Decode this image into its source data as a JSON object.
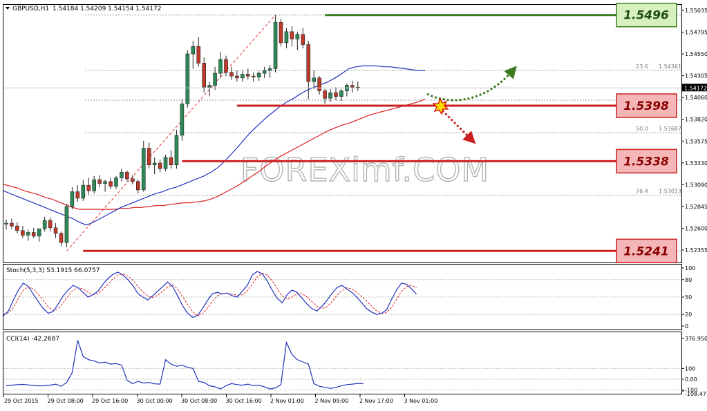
{
  "header": {
    "symbol": "GBPUSD,H1",
    "ohlc": "1.54184 1.54209 1.54154 1.54172"
  },
  "watermark": "FOREXimf.COM",
  "colors": {
    "bull": "#2e8b57",
    "bear": "#c0392b",
    "ma_fast": "#1f2fbf",
    "ma_slow": "#dd1f1f",
    "resistance": "#3a7d1e",
    "support": "#cc1f1f",
    "arrow_up": "#3d7a1f",
    "arrow_down": "#cc1f1f"
  },
  "chart_data": [
    {
      "type": "candlestick",
      "title": "GBPUSD,H1",
      "ylim": [
        1.5236,
        1.5504
      ],
      "price_ticks": [
        "1.55035",
        "1.54795",
        "1.54550",
        "1.54305",
        "1.54060",
        "1.53820",
        "1.53575",
        "1.53330",
        "1.53090",
        "1.52845",
        "1.52600",
        "1.52355"
      ],
      "current_price": "1.54172",
      "x_labels": [
        "29 Oct 2015",
        "29 Oct 08:00",
        "29 Oct 16:00",
        "30 Oct 00:00",
        "30 Oct 08:00",
        "30 Oct 16:00",
        "2 Nov 01:00",
        "2 Nov 09:00",
        "2 Nov 17:00",
        "3 Nov 01:00"
      ],
      "candles": [
        [
          1.527,
          1.5275,
          1.5264,
          1.5271
        ],
        [
          1.5271,
          1.5276,
          1.5265,
          1.5268
        ],
        [
          1.5268,
          1.5272,
          1.526,
          1.5263
        ],
        [
          1.5263,
          1.5268,
          1.5255,
          1.5258
        ],
        [
          1.5258,
          1.5264,
          1.5252,
          1.5261
        ],
        [
          1.5261,
          1.5266,
          1.5255,
          1.5257
        ],
        [
          1.5257,
          1.5262,
          1.5251,
          1.5265
        ],
        [
          1.5265,
          1.5278,
          1.5262,
          1.5274
        ],
        [
          1.5274,
          1.5277,
          1.5262,
          1.5266
        ],
        [
          1.5266,
          1.5271,
          1.5255,
          1.526
        ],
        [
          1.526,
          1.5262,
          1.5246,
          1.525
        ],
        [
          1.525,
          1.5292,
          1.5245,
          1.5289
        ],
        [
          1.5289,
          1.531,
          1.5286,
          1.5305
        ],
        [
          1.5305,
          1.5312,
          1.5294,
          1.5298
        ],
        [
          1.5298,
          1.5318,
          1.5295,
          1.5312
        ],
        [
          1.5312,
          1.532,
          1.5302,
          1.5306
        ],
        [
          1.5306,
          1.5322,
          1.5303,
          1.5318
        ],
        [
          1.5318,
          1.5323,
          1.531,
          1.5314
        ],
        [
          1.5314,
          1.5318,
          1.5305,
          1.5316
        ],
        [
          1.5316,
          1.532,
          1.5308,
          1.5311
        ],
        [
          1.5311,
          1.5322,
          1.5308,
          1.532
        ],
        [
          1.532,
          1.533,
          1.5316,
          1.5326
        ],
        [
          1.5326,
          1.5328,
          1.5316,
          1.5319
        ],
        [
          1.5319,
          1.5323,
          1.5313,
          1.5316
        ],
        [
          1.5316,
          1.5318,
          1.5303,
          1.5307
        ],
        [
          1.5307,
          1.536,
          1.5305,
          1.5352
        ],
        [
          1.5352,
          1.5358,
          1.533,
          1.5334
        ],
        [
          1.5334,
          1.5342,
          1.5324,
          1.5336
        ],
        [
          1.5336,
          1.534,
          1.5326,
          1.533
        ],
        [
          1.533,
          1.5345,
          1.5327,
          1.5342
        ],
        [
          1.5342,
          1.535,
          1.533,
          1.5334
        ],
        [
          1.5334,
          1.5372,
          1.533,
          1.5366
        ],
        [
          1.5366,
          1.5405,
          1.536,
          1.54
        ],
        [
          1.54,
          1.5458,
          1.5396,
          1.5454
        ],
        [
          1.5454,
          1.5468,
          1.5438,
          1.5462
        ],
        [
          1.5462,
          1.5472,
          1.544,
          1.5444
        ],
        [
          1.5444,
          1.545,
          1.5412,
          1.5418
        ],
        [
          1.5418,
          1.5424,
          1.5408,
          1.542
        ],
        [
          1.542,
          1.544,
          1.5415,
          1.5433
        ],
        [
          1.5433,
          1.5456,
          1.5428,
          1.5448
        ],
        [
          1.5448,
          1.5452,
          1.543,
          1.5434
        ],
        [
          1.5434,
          1.544,
          1.5426,
          1.543
        ],
        [
          1.543,
          1.5436,
          1.5424,
          1.5428
        ],
        [
          1.5428,
          1.5436,
          1.5424,
          1.5432
        ],
        [
          1.5432,
          1.5438,
          1.5426,
          1.543
        ],
        [
          1.543,
          1.5434,
          1.5424,
          1.5429
        ],
        [
          1.5429,
          1.5435,
          1.5425,
          1.5433
        ],
        [
          1.5433,
          1.544,
          1.5428,
          1.5436
        ],
        [
          1.5436,
          1.5442,
          1.5428,
          1.5438
        ],
        [
          1.5438,
          1.5496,
          1.5434,
          1.5488
        ],
        [
          1.5488,
          1.5492,
          1.5462,
          1.5466
        ],
        [
          1.5466,
          1.5482,
          1.546,
          1.5478
        ],
        [
          1.5478,
          1.5484,
          1.5462,
          1.547
        ],
        [
          1.547,
          1.5478,
          1.5458,
          1.5475
        ],
        [
          1.5475,
          1.5482,
          1.546,
          1.5464
        ],
        [
          1.5464,
          1.5468,
          1.5405,
          1.5424
        ],
        [
          1.5424,
          1.5436,
          1.5416,
          1.5428
        ],
        [
          1.5428,
          1.543,
          1.541,
          1.5414
        ],
        [
          1.5414,
          1.5416,
          1.54,
          1.5406
        ],
        [
          1.5406,
          1.5416,
          1.5402,
          1.5412
        ],
        [
          1.5412,
          1.5418,
          1.5404,
          1.5408
        ],
        [
          1.5408,
          1.5416,
          1.5403,
          1.5414
        ],
        [
          1.5414,
          1.5422,
          1.5408,
          1.542
        ],
        [
          1.542,
          1.5425,
          1.5412,
          1.5418
        ],
        [
          1.5418,
          1.5424,
          1.5414,
          1.5417
        ]
      ],
      "ma_fast": [
        1.5306,
        1.5303,
        1.53,
        1.5297,
        1.5294,
        1.5291,
        1.5288,
        1.5285,
        1.5282,
        1.5279,
        1.5276,
        1.5272,
        1.5269,
        1.5272,
        1.5276,
        1.528,
        1.5284,
        1.5288,
        1.5291,
        1.5294,
        1.5297,
        1.53,
        1.5303,
        1.5305,
        1.5308,
        1.531,
        1.5313,
        1.5316,
        1.5319,
        1.5322,
        1.5326,
        1.5331,
        1.5338,
        1.5346,
        1.5354,
        1.5363,
        1.5371,
        1.5378,
        1.5385,
        1.5391,
        1.5397,
        1.5402,
        1.5406,
        1.5411,
        1.5415,
        1.5418,
        1.5421,
        1.5424,
        1.5428,
        1.5433,
        1.5438,
        1.544,
        1.5441,
        1.5441,
        1.5441,
        1.544,
        1.544,
        1.5439,
        1.5438,
        1.5437,
        1.5436,
        1.5436
      ],
      "ma_slow": [
        1.5313,
        1.5311,
        1.5309,
        1.5306,
        1.5304,
        1.5302,
        1.5299,
        1.5297,
        1.5294,
        1.5291,
        1.5288,
        1.5286,
        1.5286,
        1.5286,
        1.5286,
        1.5286,
        1.5286,
        1.5287,
        1.5287,
        1.5288,
        1.5288,
        1.5289,
        1.529,
        1.529,
        1.5291,
        1.5292,
        1.5293,
        1.5293,
        1.5294,
        1.5295,
        1.5297,
        1.53,
        1.5304,
        1.5308,
        1.5312,
        1.5317,
        1.5322,
        1.5327,
        1.5333,
        1.5338,
        1.5343,
        1.5347,
        1.5351,
        1.5355,
        1.5359,
        1.5363,
        1.5367,
        1.5371,
        1.5374,
        1.5377,
        1.5379,
        1.5382,
        1.5385,
        1.5388,
        1.539,
        1.5392,
        1.5394,
        1.5396,
        1.5398,
        1.54,
        1.5402,
        1.5405
      ],
      "fibonacci": [
        {
          "ratio": "23.6",
          "price": "1.54361",
          "value": 1.54361
        },
        {
          "ratio": "50.0",
          "price": "1.53687",
          "value": 1.53687
        },
        {
          "ratio": "76.4",
          "price": "1.53013",
          "value": 1.53013
        }
      ],
      "levels": [
        {
          "label": "1.5496",
          "value": 1.5496,
          "kind": "resistance"
        },
        {
          "label": "1.5398",
          "value": 1.5398,
          "kind": "support"
        },
        {
          "label": "1.5338",
          "value": 1.5338,
          "kind": "support"
        },
        {
          "label": "1.5241",
          "value": 1.5241,
          "kind": "support"
        }
      ]
    },
    {
      "type": "line",
      "title": "Stoch(5,3,3) 53.1915 66.0757",
      "ylim": [
        0,
        100
      ],
      "y_ticks": [
        "100",
        "80",
        "50",
        "20",
        "0"
      ],
      "series": [
        {
          "values": [
            18,
            26,
            45,
            62,
            74,
            68,
            55,
            42,
            30,
            22,
            25,
            38,
            52,
            62,
            70,
            66,
            58,
            50,
            54,
            60,
            72,
            82,
            89,
            93,
            88,
            80,
            70,
            56,
            50,
            45,
            52,
            60,
            68,
            76,
            68,
            52,
            35,
            22,
            15,
            18,
            30,
            44,
            56,
            58,
            55,
            57,
            52,
            50,
            60,
            70,
            88,
            94,
            90,
            78,
            62,
            48,
            40,
            54,
            62,
            58,
            48,
            38,
            30,
            26,
            34,
            44,
            56,
            66,
            70,
            64,
            58,
            50,
            40,
            30,
            24,
            20,
            22,
            28,
            46,
            62,
            74,
            72,
            64,
            55
          ]
        },
        {
          "values": [
            20,
            23,
            32,
            48,
            62,
            68,
            64,
            55,
            44,
            33,
            27,
            30,
            40,
            52,
            62,
            66,
            64,
            58,
            54,
            56,
            63,
            72,
            81,
            88,
            90,
            86,
            79,
            68,
            59,
            52,
            49,
            53,
            60,
            67,
            71,
            64,
            51,
            37,
            25,
            18,
            21,
            31,
            43,
            52,
            56,
            56,
            55,
            53,
            54,
            60,
            72,
            85,
            91,
            88,
            78,
            65,
            52,
            46,
            50,
            56,
            56,
            50,
            42,
            34,
            30,
            33,
            42,
            53,
            61,
            66,
            64,
            58,
            51,
            43,
            34,
            26,
            22,
            23,
            32,
            46,
            60,
            68,
            70,
            66
          ]
        }
      ]
    },
    {
      "type": "line",
      "title": "CCI(14) -42.2687",
      "ylim": [
        -108.47,
        376.95
      ],
      "y_ticks": [
        "376.950",
        "100",
        "0.00",
        "-100",
        "-108.47"
      ],
      "series": [
        {
          "values": [
            -60,
            -55,
            -50,
            -48,
            -52,
            -58,
            -62,
            -60,
            -55,
            -45,
            -65,
            -30,
            60,
            360,
            210,
            180,
            170,
            150,
            158,
            140,
            145,
            130,
            -10,
            -40,
            -20,
            -35,
            -30,
            -42,
            -45,
            180,
            140,
            120,
            130,
            110,
            100,
            -20,
            -30,
            -60,
            -70,
            -90,
            -60,
            -40,
            -50,
            -55,
            -45,
            -60,
            -55,
            -70,
            -90,
            -80,
            -50,
            340,
            230,
            180,
            160,
            140,
            -40,
            -65,
            -75,
            -85,
            -75,
            -60,
            -50,
            -45,
            -38,
            -42
          ]
        }
      ]
    }
  ]
}
